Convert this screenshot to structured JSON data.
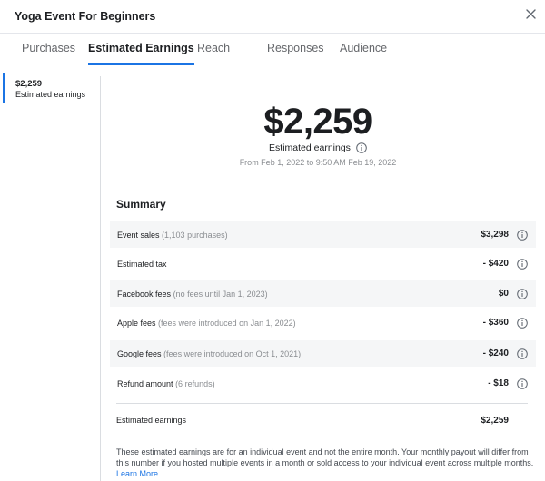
{
  "header": {
    "title": "Yoga Event For Beginners",
    "close_icon": "close-icon"
  },
  "tabs": [
    {
      "label": "Purchases",
      "active": false
    },
    {
      "label": "Estimated Earnings",
      "active": true
    },
    {
      "label": "Reach",
      "active": false
    },
    {
      "label": "Responses",
      "active": false
    },
    {
      "label": "Audience",
      "active": false
    }
  ],
  "sidebar": {
    "amount": "$2,259",
    "label": "Estimated earnings"
  },
  "overview": {
    "amount": "$2,259",
    "label": "Estimated earnings",
    "range": "From Feb 1, 2022 to 9:50 AM Feb 19, 2022"
  },
  "summary": {
    "title": "Summary",
    "rows": [
      {
        "label": "Event sales",
        "note": "(1,103 purchases)",
        "value": "$3,298"
      },
      {
        "label": "Estimated tax",
        "note": "",
        "value": "- $420"
      },
      {
        "label": "Facebook fees",
        "note": "(no fees until Jan 1, 2023)",
        "value": "$0"
      },
      {
        "label": "Apple fees",
        "note": "(fees were introduced on Jan 1, 2022)",
        "value": "- $360"
      },
      {
        "label": "Google fees",
        "note": "(fees were introduced on Oct 1, 2021)",
        "value": "- $240"
      },
      {
        "label": "Refund amount",
        "note": "(6 refunds)",
        "value": "- $18"
      }
    ],
    "total_label": "Estimated earnings",
    "total_value": "$2,259"
  },
  "disclaimer": {
    "text": "These estimated earnings are for an individual event and not the entire month. Your monthly payout will differ from this number if you hosted multiple events in a month or sold access to your individual event across multiple months.",
    "link": "Learn More"
  },
  "colors": {
    "accent": "#1b74e4",
    "shaded_row": "#f5f6f7",
    "muted_text": "#8a8d91"
  }
}
